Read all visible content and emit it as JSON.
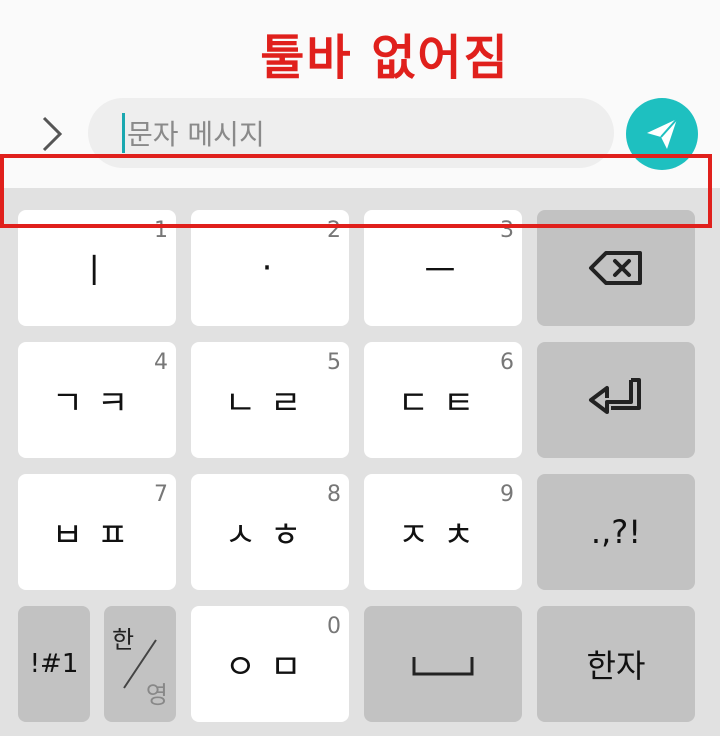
{
  "annotation": {
    "title": "툴바 없어짐",
    "color": "#e0201c"
  },
  "composer": {
    "placeholder": "문자 메시지",
    "expand_icon": "chevron-right-icon",
    "send_icon": "send-paper-plane-icon",
    "accent": "#1ec0c0"
  },
  "keyboard": {
    "row1": [
      {
        "label": "ㅣ",
        "num": "1"
      },
      {
        "label": "·",
        "num": "2"
      },
      {
        "label": "ㅡ",
        "num": "3"
      },
      {
        "icon": "backspace-icon"
      }
    ],
    "row2": [
      {
        "label": "ㄱㅋ",
        "num": "4"
      },
      {
        "label": "ㄴㄹ",
        "num": "5"
      },
      {
        "label": "ㄷㅌ",
        "num": "6"
      },
      {
        "icon": "enter-icon"
      }
    ],
    "row3": [
      {
        "label": "ㅂㅍ",
        "num": "7"
      },
      {
        "label": "ㅅㅎ",
        "num": "8"
      },
      {
        "label": "ㅈㅊ",
        "num": "9"
      },
      {
        "label": ".,?!"
      }
    ],
    "row4": {
      "symbols": "!#1",
      "lang_han": "한",
      "lang_eng": "영",
      "vowel": {
        "label": "ㅇㅁ",
        "num": "0"
      },
      "space_icon": "space-bar-icon",
      "hanja": "한자"
    }
  }
}
